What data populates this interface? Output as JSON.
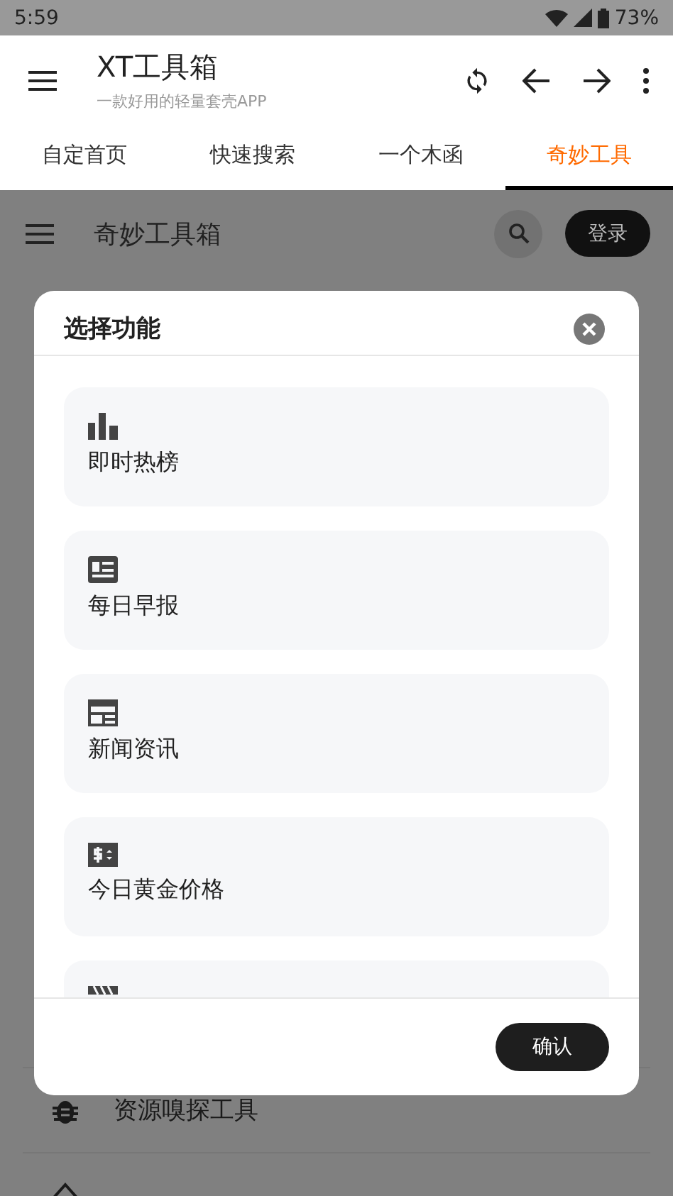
{
  "status_bar": {
    "time": "5:59",
    "battery": "73%"
  },
  "app_bar": {
    "title": "XT工具箱",
    "subtitle": "一款好用的轻量套壳APP"
  },
  "tabs": [
    {
      "label": "自定首页",
      "selected": false
    },
    {
      "label": "快速搜索",
      "selected": false
    },
    {
      "label": "一个木函",
      "selected": false
    },
    {
      "label": "奇妙工具",
      "selected": true
    }
  ],
  "page": {
    "title": "奇妙工具箱",
    "login_button": "登录",
    "rows": [
      {
        "label": "资源嗅探工具"
      }
    ]
  },
  "dialog": {
    "title": "选择功能",
    "options": [
      {
        "label": "即时热榜"
      },
      {
        "label": "每日早报"
      },
      {
        "label": "新闻资讯"
      },
      {
        "label": "今日黄金价格"
      }
    ],
    "confirm_button": "确认"
  }
}
